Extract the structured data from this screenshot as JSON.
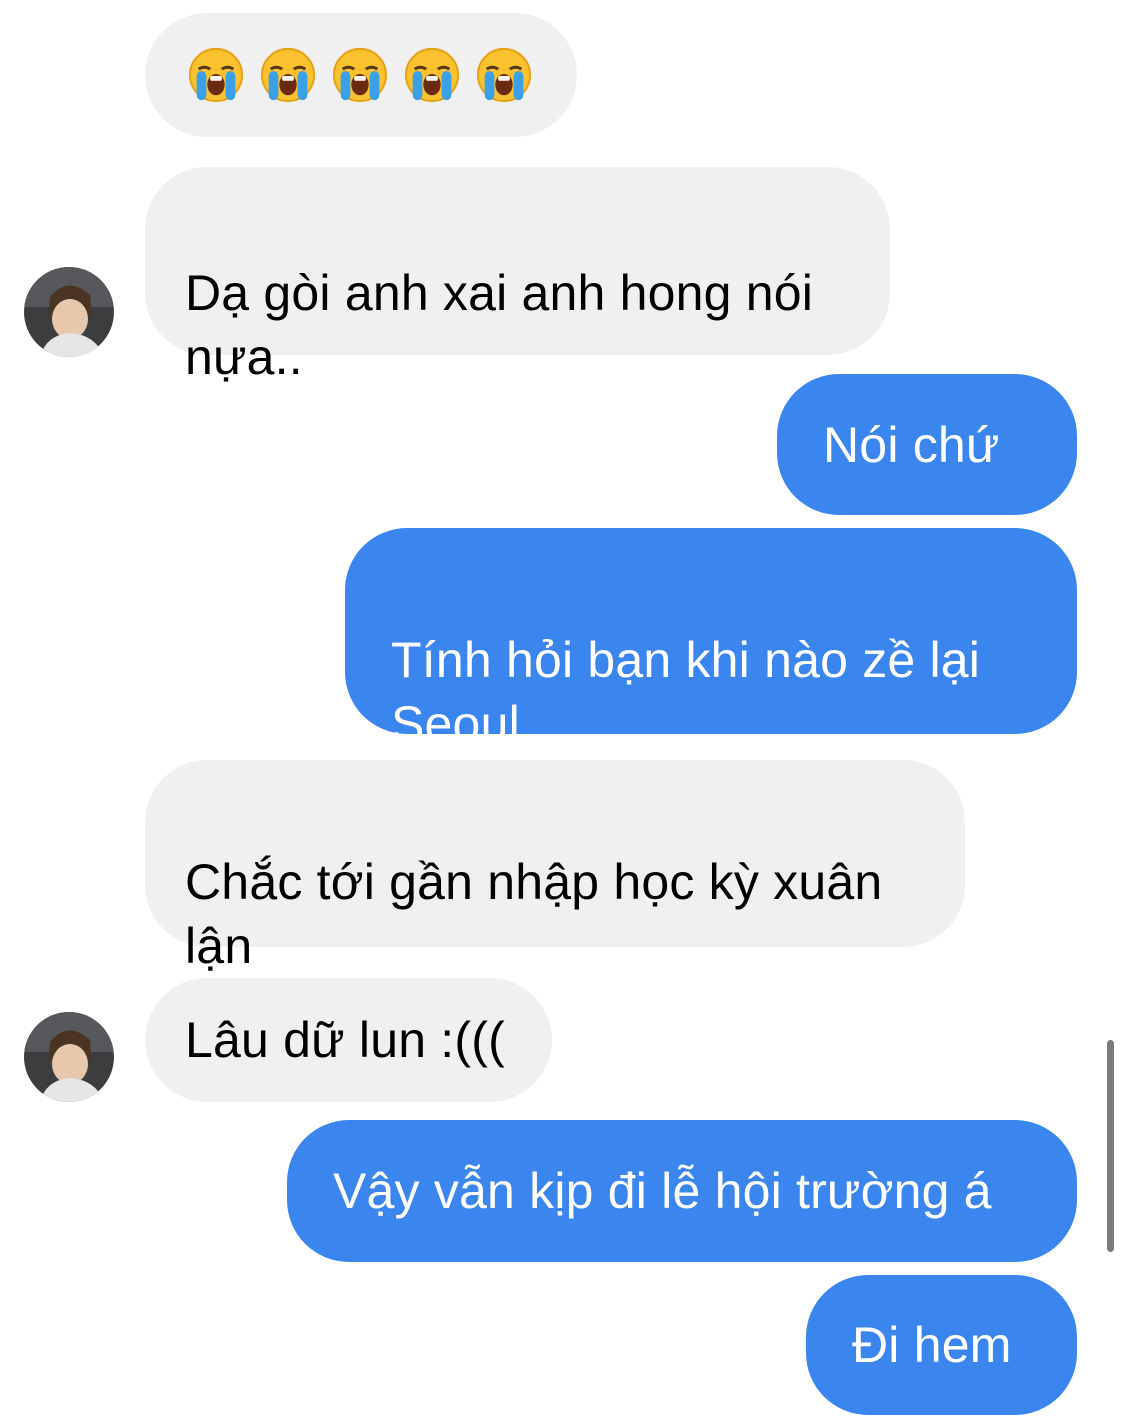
{
  "messages": {
    "m0_emojis": [
      "😭",
      "😭",
      "😭",
      "😭",
      "😭"
    ],
    "m1_text": "Dạ gòi anh xai anh hong nói\nnựa..",
    "m2_text": "Nói chứ",
    "m3_text": "Tính hỏi bạn khi nào zề lại\nSeoul",
    "m4_text": "Chắc tới gần nhập học kỳ xuân\nlận",
    "m5_text": "Lâu dữ lun :(((",
    "m6_text": "Vậy vẫn kịp đi lễ hội trường á",
    "m7_text": "Đi hem"
  },
  "colors": {
    "incoming_bubble": "#f0f0f0",
    "outgoing_bubble": "#3b86ee",
    "incoming_text": "#000000",
    "outgoing_text": "#ffffff"
  },
  "icons": {
    "emoji": "loudly-crying-face-icon",
    "avatar": "contact-avatar"
  }
}
